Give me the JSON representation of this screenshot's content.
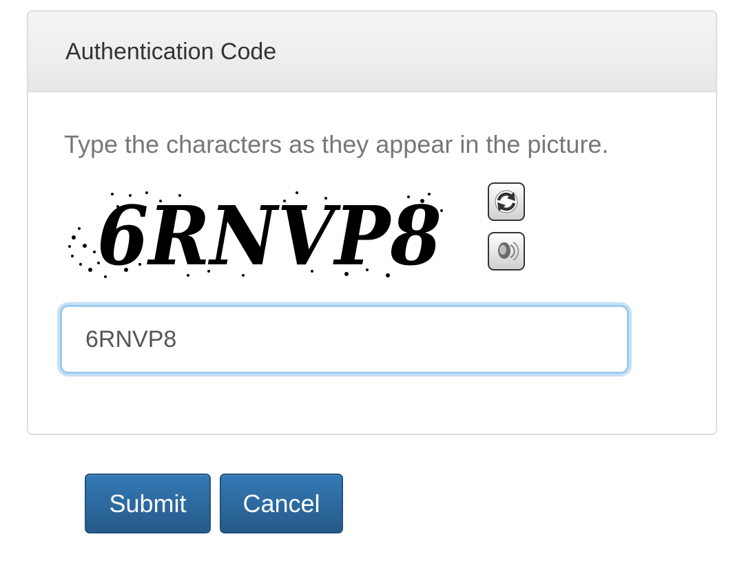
{
  "panel": {
    "title": "Authentication Code",
    "instruction": "Type the characters as they appear in the picture."
  },
  "captcha": {
    "image_text": "6RNVP8",
    "refresh_icon": "refresh-icon",
    "audio_icon": "speaker-icon"
  },
  "input": {
    "value": "6RNVP8",
    "placeholder": ""
  },
  "buttons": {
    "submit_label": "Submit",
    "cancel_label": "Cancel"
  },
  "colors": {
    "button_primary": "#337ab7",
    "input_focus_border": "#9ecaed",
    "panel_border": "#dddddd",
    "heading_text": "#333333",
    "instruction_text": "#777777"
  }
}
